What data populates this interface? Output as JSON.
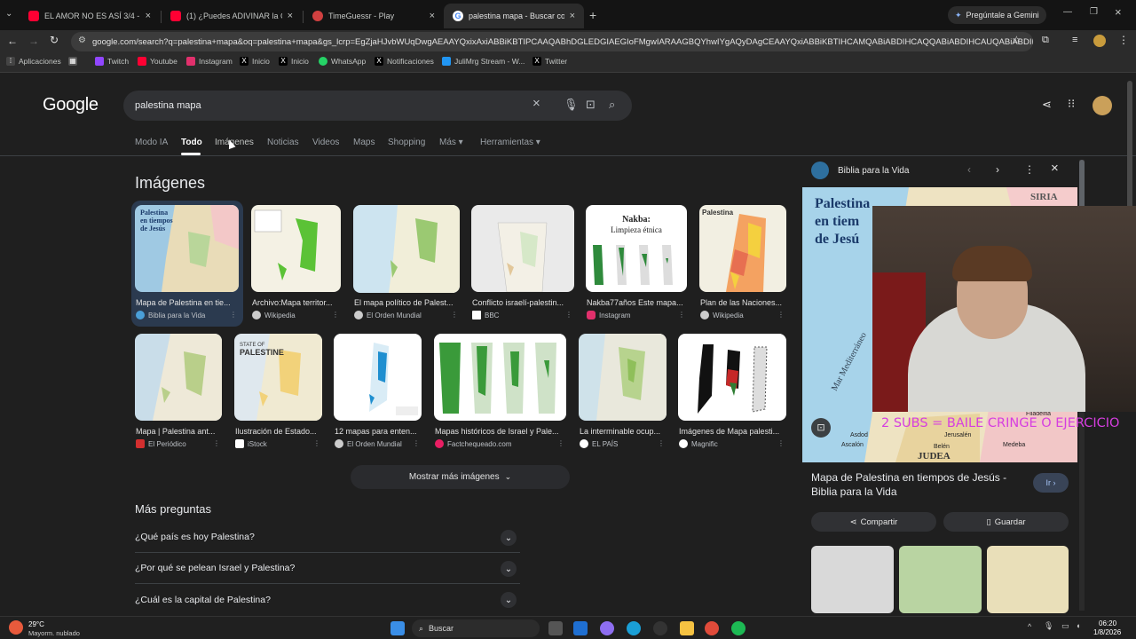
{
  "tabs": [
    {
      "title": "EL AMOR NO ES ASÍ 3/4 - YouT",
      "favicon_color": "#ff0033",
      "active": false
    },
    {
      "title": "(1) ¿Puedes ADIVINAR la CANC",
      "favicon_color": "#ff0033",
      "active": false
    },
    {
      "title": "TimeGuessr - Play",
      "favicon_color": "#d04040",
      "active": false
    },
    {
      "title": "palestina mapa - Buscar con Go",
      "favicon_color": "#4285f4",
      "active": true
    }
  ],
  "gemini_button": "Pregúntale a Gemini",
  "url": "google.com/search?q=palestina+mapa&oq=palestina+mapa&gs_lcrp=EgZjaHJvbWUqDwgAEAAYQxixAxiABBiKBTIPCAAQABhDGLEDGIAEGIoFMgwIARAAGBQYhwIYgAQyDAgCEAAYQxiABBiKBTIHCAMQABiABDIHCAQQABiABDIHCAUQABiABDIHCAY...",
  "bookmarks": [
    "Aplicaciones",
    "Twitch",
    "Youtube",
    "Instagram",
    "Inicio",
    "Inicio",
    "WhatsApp",
    "Notificaciones",
    "JuliMrg Stream - W...",
    "Twitter"
  ],
  "logo": "Google",
  "search_query": "palestina mapa",
  "nav_tabs": [
    "Modo IA",
    "Todo",
    "Imágenes",
    "Noticias",
    "Videos",
    "Maps",
    "Shopping",
    "Más",
    "Herramientas"
  ],
  "section_title": "Imágenes",
  "images_row1": [
    {
      "label": "Mapa de Palestina en tie...",
      "source": "Biblia para la Vida",
      "src_color": "#4a9fd8"
    },
    {
      "label": "Archivo:Mapa territor...",
      "source": "Wikipedia",
      "src_color": "#cccccc"
    },
    {
      "label": "El mapa político de Palest...",
      "source": "El Orden Mundial",
      "src_color": "#cccccc"
    },
    {
      "label": "Conflicto israelí-palestin...",
      "source": "BBC",
      "src_color": "#ffffff"
    },
    {
      "label": "Nakba77años Este mapa...",
      "source": "Instagram",
      "src_color": "#e1306c"
    },
    {
      "label": "Plan de las Naciones...",
      "source": "Wikipedia",
      "src_color": "#cccccc"
    }
  ],
  "images_row2": [
    {
      "label": "Mapa | Palestina ant...",
      "source": "El Periódico",
      "src_color": "#d32f2f"
    },
    {
      "label": "Ilustración de Estado...",
      "source": "iStock",
      "src_color": "#ffffff"
    },
    {
      "label": "12 mapas para enten...",
      "source": "El Orden Mundial",
      "src_color": "#cccccc"
    },
    {
      "label": "Mapas históricos de Israel y Pale...",
      "source": "Factchequeado.com",
      "src_color": "#e91e63"
    },
    {
      "label": "La interminable ocup...",
      "source": "EL PAÍS",
      "src_color": "#ffffff"
    },
    {
      "label": "Imágenes de Mapa palesti...",
      "source": "Magnific",
      "src_color": "#ffffff"
    }
  ],
  "thumb_texts": {
    "t1": [
      "Palestina",
      "en tiempos",
      "de Jesús"
    ],
    "t5": [
      "Nakba:",
      "Limpieza étnica"
    ],
    "t6": "Palestina",
    "t8": [
      "STATE OF",
      "PALESTINE"
    ]
  },
  "more_images": "Mostrar más imágenes",
  "mas_preguntas": "Más preguntas",
  "faqs": [
    "¿Qué país es hoy Palestina?",
    "¿Por qué se pelean Israel y Palestina?",
    "¿Cuál es la capital de Palestina?"
  ],
  "panel": {
    "source": "Biblia para la Vida",
    "title": "Mapa de Palestina en tiempos de Jesús - Biblia para la Vida",
    "go": "Ir",
    "share": "Compartir",
    "save": "Guardar",
    "map_title": [
      "Palestina",
      "en tiem",
      "de Jesú"
    ],
    "map_labels": [
      "SIRIA",
      "Mar Mediterráneo",
      "JUDEA",
      "Asdod",
      "Ascalón",
      "Belén",
      "Jerusalén",
      "Medeba",
      "Filadelfia"
    ]
  },
  "stream_overlay": "2 SUBS = BAILE CRINGE O EJERCICIO",
  "weather": {
    "temp": "29°C",
    "desc": "Mayorm. nublado"
  },
  "taskbar_search": "Buscar",
  "clock": {
    "time": "06:20",
    "date": "1/8/2026"
  }
}
